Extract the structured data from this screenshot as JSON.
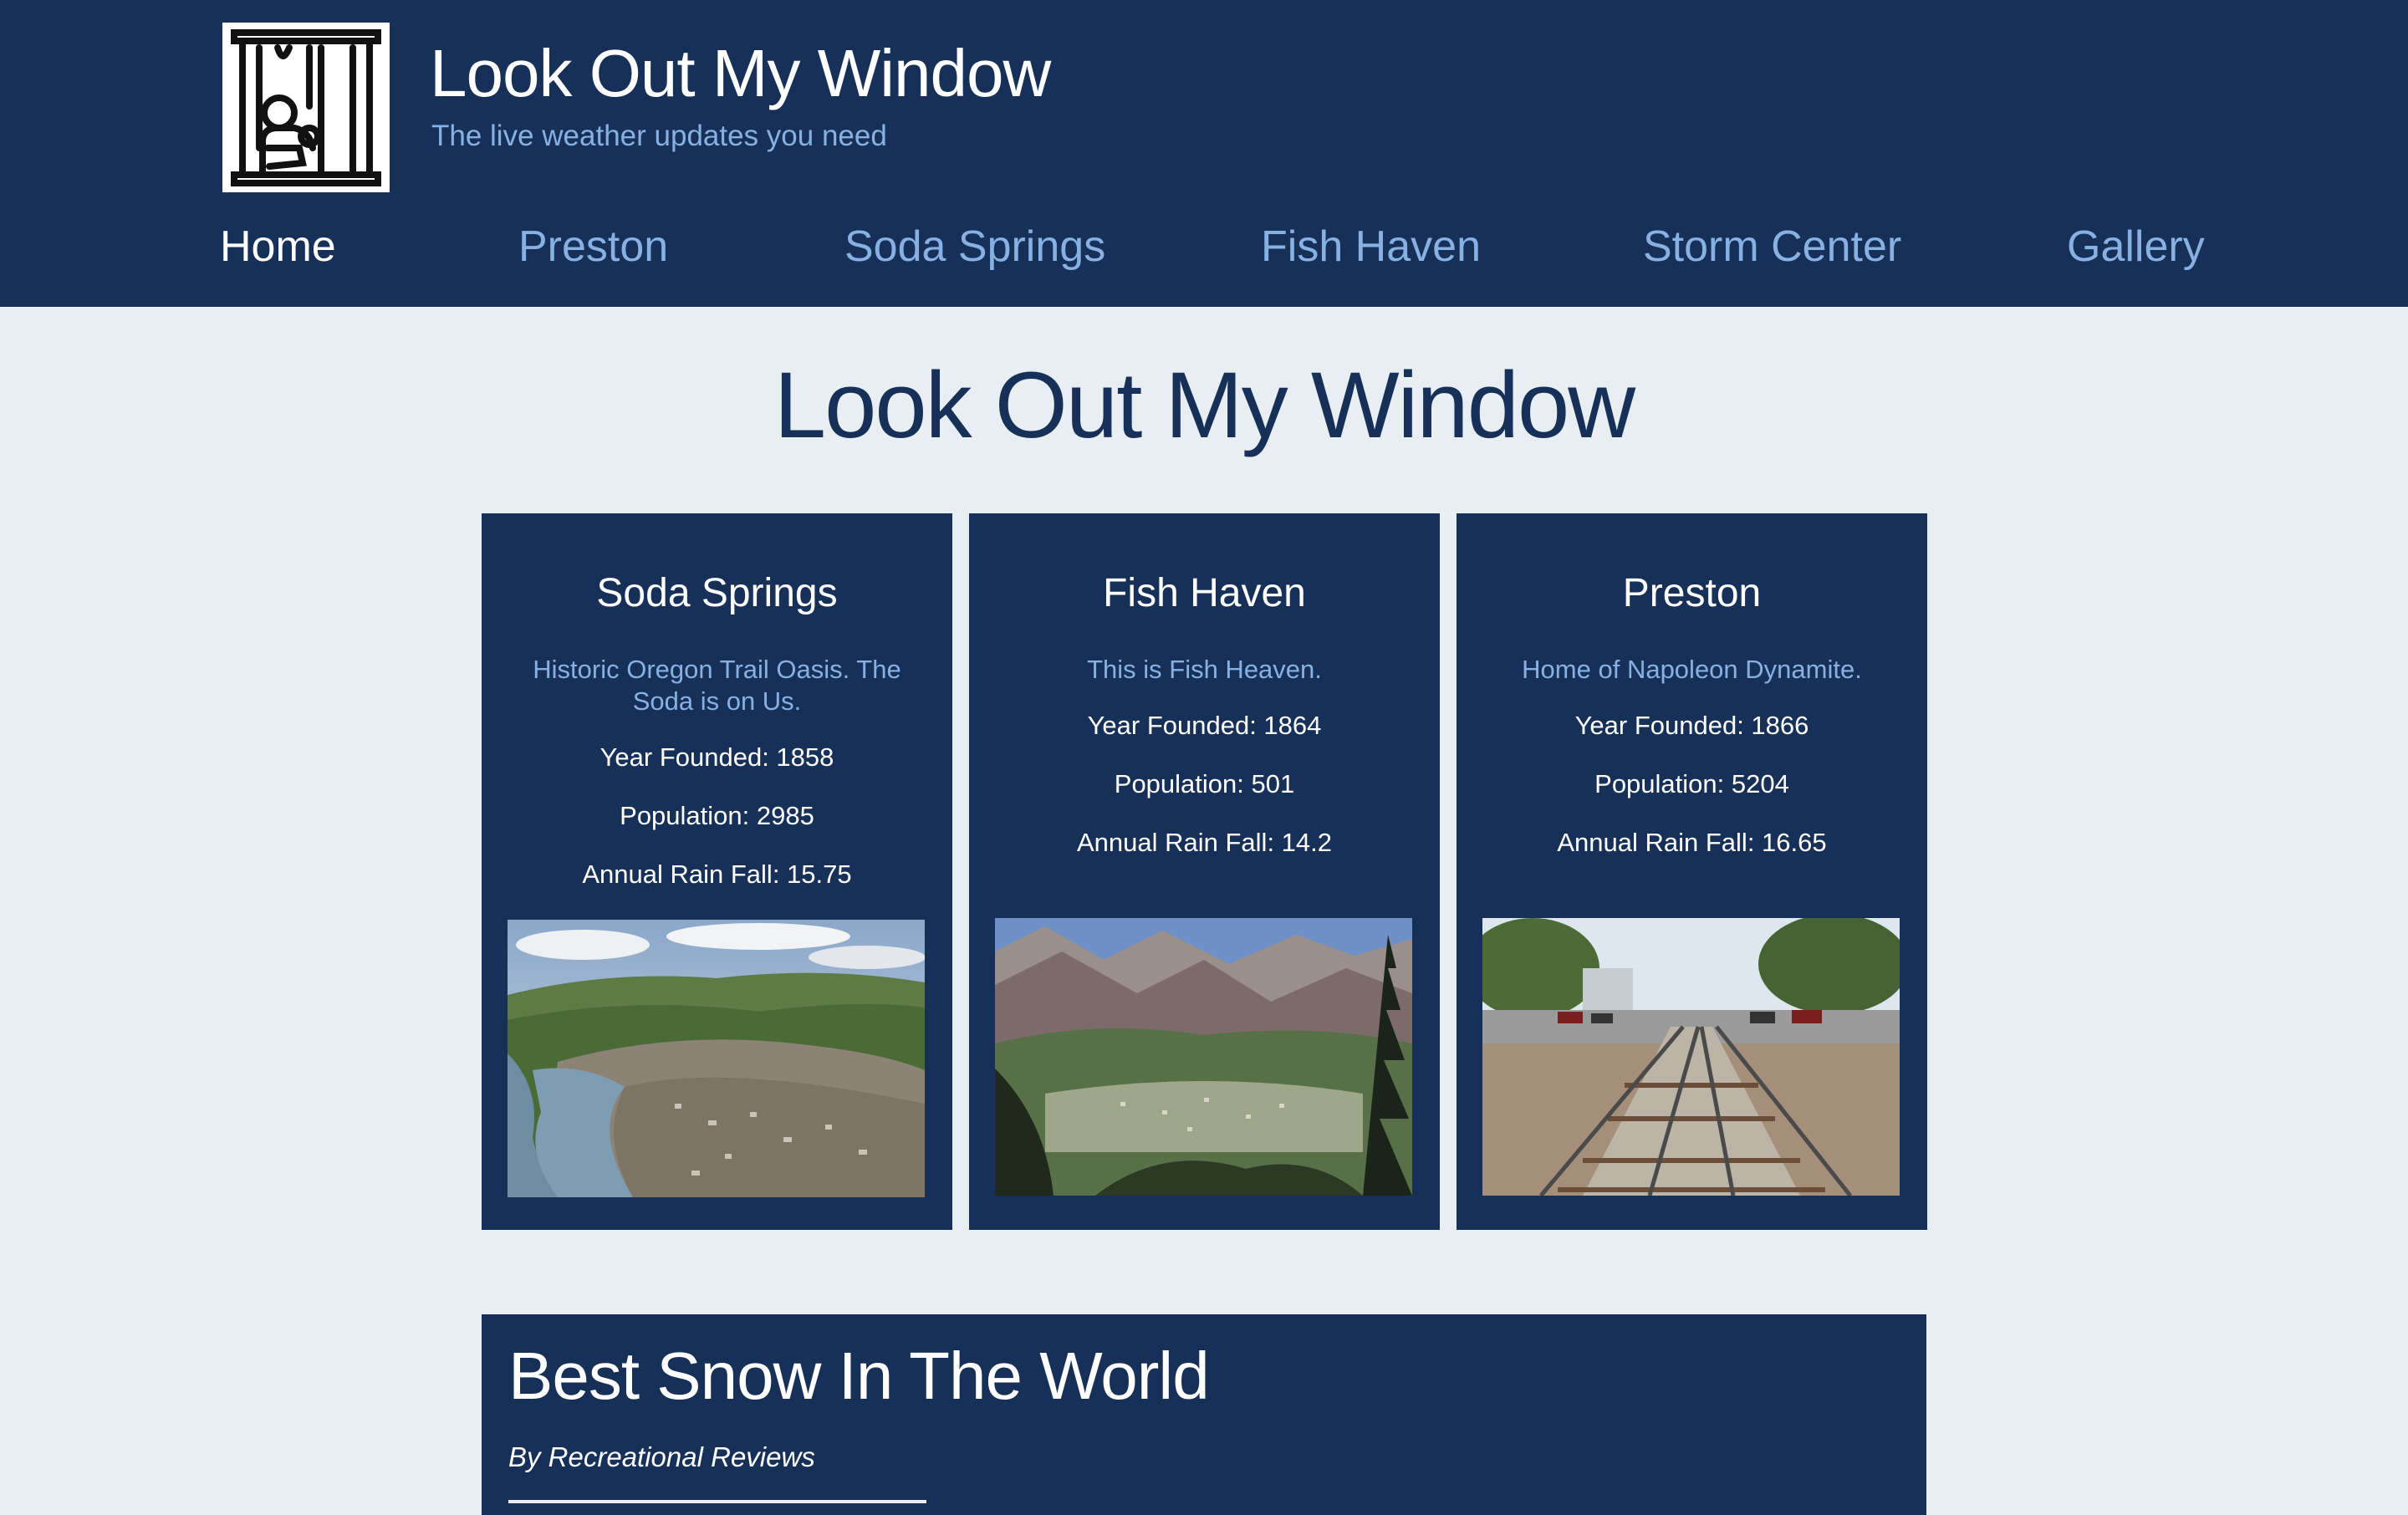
{
  "header": {
    "title": "Look Out My Window",
    "tagline": "The live weather updates you need"
  },
  "nav": [
    {
      "label": "Home",
      "active": true
    },
    {
      "label": "Preston",
      "active": false
    },
    {
      "label": "Soda Springs",
      "active": false
    },
    {
      "label": "Fish Haven",
      "active": false
    },
    {
      "label": "Storm Center",
      "active": false
    },
    {
      "label": "Gallery",
      "active": false
    }
  ],
  "main": {
    "heading": "Look Out My Window",
    "towns": [
      {
        "name": "Soda Springs",
        "motto": "Historic Oregon Trail Oasis. The Soda is on Us.",
        "founded": "Year Founded: 1858",
        "population": "Population: 2985",
        "rainfall": "Annual Rain Fall: 15.75"
      },
      {
        "name": "Fish Haven",
        "motto": "This is Fish Heaven.",
        "founded": "Year Founded: 1864",
        "population": "Population: 501",
        "rainfall": "Annual Rain Fall: 14.2"
      },
      {
        "name": "Preston",
        "motto": "Home of Napoleon Dynamite.",
        "founded": "Year Founded: 1866",
        "population": "Population: 5204",
        "rainfall": "Annual Rain Fall: 16.65"
      }
    ],
    "feature": {
      "title": "Best Snow In The World",
      "byline": "By Recreational Reviews"
    }
  },
  "colors": {
    "header_bg": "#173058",
    "accent": "#87b1e3",
    "page_bg": "#e8eef2"
  }
}
